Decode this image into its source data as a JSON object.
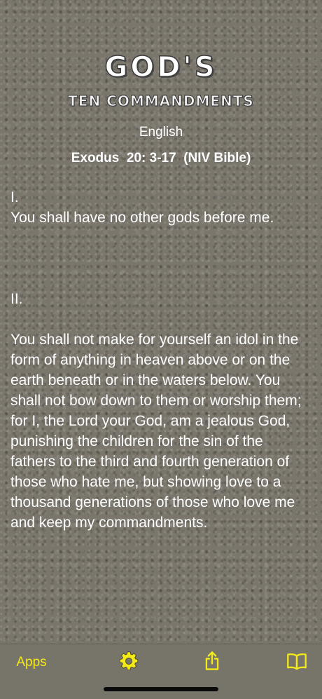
{
  "header": {
    "logo_title": "GOD'S",
    "logo_subtitle": "TEN COMMANDMENTS",
    "language": "English",
    "reference": "Exodus  20: 3-17  (NIV Bible)"
  },
  "commandments": [
    {
      "numeral": "I.",
      "text": "You shall have no other gods before me."
    },
    {
      "numeral": "II.",
      "text": "You shall not make for yourself an idol in the form of anything in heaven above or on the earth beneath or in the waters below.  You shall not bow down to them or worship them; for I, the Lord your God, am a jealous God, punishing the children for the sin of the fathers to the third and fourth generation of those who hate me, but showing love to a thousand generations of those who love me and keep my commandments."
    }
  ],
  "tabbar": {
    "apps_label": "Apps",
    "settings_icon": "gear-icon",
    "share_icon": "share-icon",
    "book_icon": "book-icon"
  },
  "colors": {
    "accent": "#f4ea1a",
    "background": "#7a766c",
    "text": "#ffffff"
  }
}
